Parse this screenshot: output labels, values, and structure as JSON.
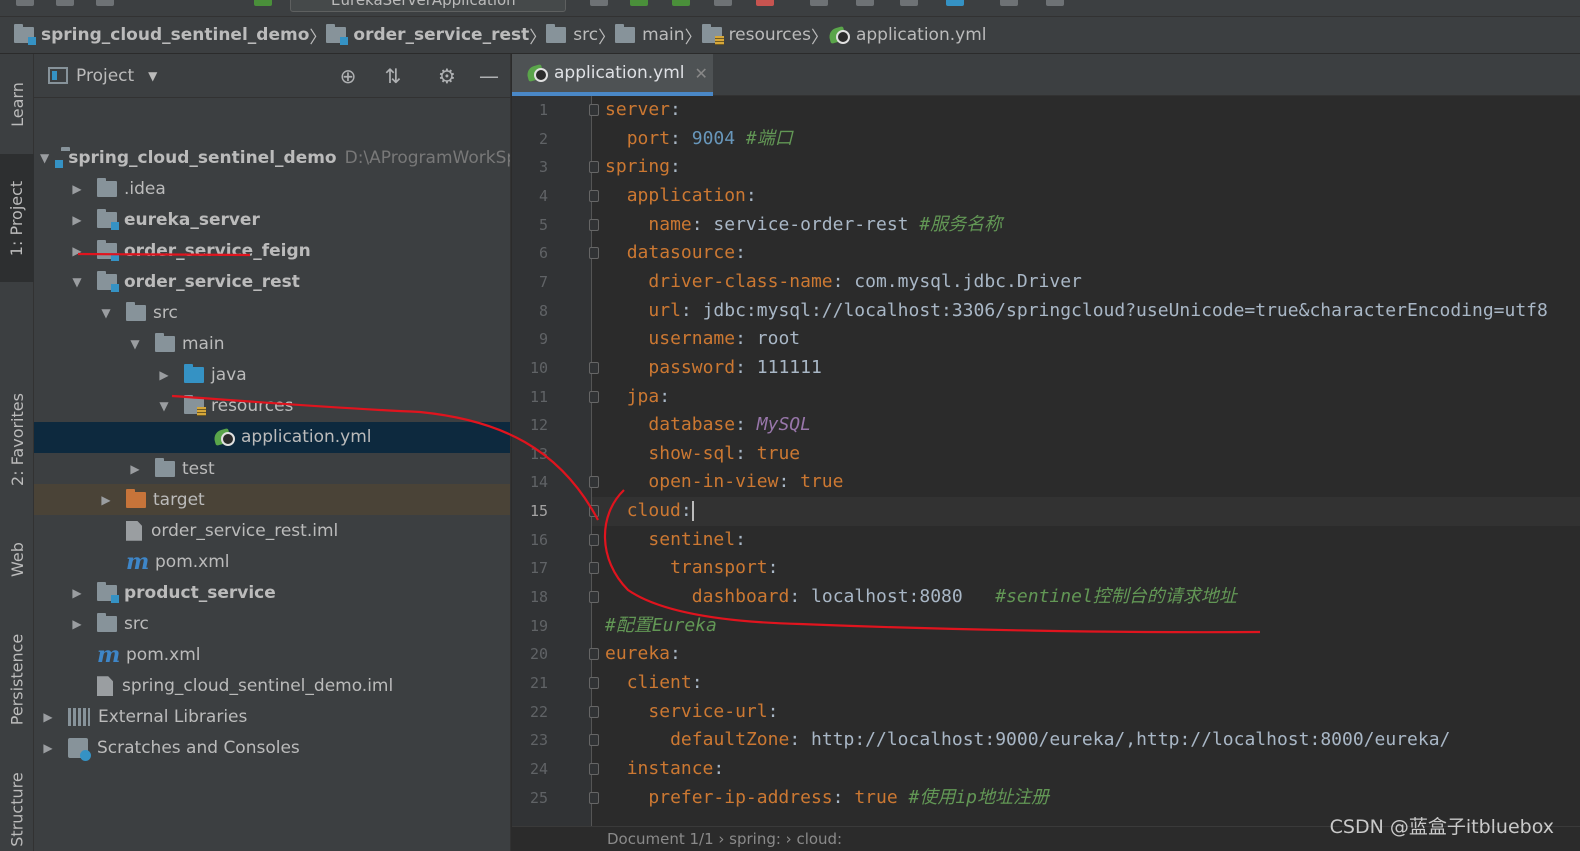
{
  "toolbar": {
    "run_config": "EurekaServerApplication"
  },
  "breadcrumb": [
    {
      "label": "spring_cloud_sentinel_demo",
      "icon": "module-folder-icon",
      "bold": true
    },
    {
      "label": "order_service_rest",
      "icon": "module-folder-icon",
      "bold": true
    },
    {
      "label": "src",
      "icon": "folder-icon",
      "bold": false
    },
    {
      "label": "main",
      "icon": "folder-icon",
      "bold": false
    },
    {
      "label": "resources",
      "icon": "resources-folder-icon",
      "bold": false
    },
    {
      "label": "application.yml",
      "icon": "yml-spring-icon",
      "bold": false
    }
  ],
  "left_strip": {
    "learn": "Learn",
    "project": "1: Project",
    "favorites": "2: Favorites",
    "web": "Web",
    "persistence": "Persistence",
    "structure": "Structure"
  },
  "project_panel": {
    "title": "Project",
    "tree": [
      {
        "label": "spring_cloud_sentinel_demo",
        "path": "D:\\AProgramWorkSp",
        "level": 0,
        "expanded": true,
        "icon": "module",
        "bold": true
      },
      {
        "label": ".idea",
        "level": 1,
        "expanded": false,
        "icon": "folder"
      },
      {
        "label": "eureka_server",
        "level": 1,
        "expanded": false,
        "icon": "module",
        "bold": true
      },
      {
        "label": "order_service_feign",
        "level": 1,
        "expanded": false,
        "icon": "module",
        "bold": true
      },
      {
        "label": "order_service_rest",
        "level": 1,
        "expanded": true,
        "icon": "module",
        "bold": true
      },
      {
        "label": "src",
        "level": 2,
        "expanded": true,
        "icon": "folder"
      },
      {
        "label": "main",
        "level": 3,
        "expanded": true,
        "icon": "folder"
      },
      {
        "label": "java",
        "level": 4,
        "expanded": false,
        "icon": "source-folder"
      },
      {
        "label": "resources",
        "level": 4,
        "expanded": true,
        "icon": "resources-folder"
      },
      {
        "label": "application.yml",
        "level": 5,
        "leaf": true,
        "icon": "yml",
        "selected": true
      },
      {
        "label": "test",
        "level": 3,
        "expanded": false,
        "icon": "folder"
      },
      {
        "label": "target",
        "level": 2,
        "expanded": false,
        "icon": "excluded-folder",
        "highlight": true
      },
      {
        "label": "order_service_rest.iml",
        "level": 2,
        "leaf": true,
        "icon": "iml"
      },
      {
        "label": "pom.xml",
        "level": 2,
        "leaf": true,
        "icon": "maven"
      },
      {
        "label": "product_service",
        "level": 1,
        "expanded": false,
        "icon": "module",
        "bold": true
      },
      {
        "label": "src",
        "level": 1,
        "expanded": false,
        "icon": "folder"
      },
      {
        "label": "pom.xml",
        "level": 1,
        "leaf": true,
        "icon": "maven"
      },
      {
        "label": "spring_cloud_sentinel_demo.iml",
        "level": 1,
        "leaf": true,
        "icon": "iml"
      },
      {
        "label": "External Libraries",
        "level": 0,
        "expanded": false,
        "icon": "libraries"
      },
      {
        "label": "Scratches and Consoles",
        "level": 0,
        "expanded": false,
        "icon": "scratches"
      }
    ]
  },
  "editor": {
    "tab_label": "application.yml",
    "current_line": 15,
    "lines": [
      {
        "no": 1,
        "indent": 0,
        "fold": true,
        "parts": [
          [
            "k",
            "server"
          ],
          [
            "v",
            ":"
          ]
        ]
      },
      {
        "no": 2,
        "indent": 1,
        "parts": [
          [
            "k",
            "port"
          ],
          [
            "v",
            ": "
          ],
          [
            "n",
            "9004 "
          ],
          [
            "c",
            "#端口"
          ]
        ]
      },
      {
        "no": 3,
        "indent": 0,
        "fold": true,
        "parts": [
          [
            "k",
            "spring"
          ],
          [
            "v",
            ":"
          ]
        ]
      },
      {
        "no": 4,
        "indent": 1,
        "fold": true,
        "parts": [
          [
            "k",
            "application"
          ],
          [
            "v",
            ":"
          ]
        ]
      },
      {
        "no": 5,
        "indent": 2,
        "fold": true,
        "parts": [
          [
            "k",
            "name"
          ],
          [
            "v",
            ": service-order-rest "
          ],
          [
            "c",
            "#服务名称"
          ]
        ]
      },
      {
        "no": 6,
        "indent": 1,
        "fold": true,
        "parts": [
          [
            "k",
            "datasource"
          ],
          [
            "v",
            ":"
          ]
        ]
      },
      {
        "no": 7,
        "indent": 2,
        "parts": [
          [
            "k",
            "driver-class-name"
          ],
          [
            "v",
            ": com.mysql.jdbc.Driver"
          ]
        ]
      },
      {
        "no": 8,
        "indent": 2,
        "parts": [
          [
            "k",
            "url"
          ],
          [
            "v",
            ": jdbc:mysql://localhost:3306/springcloud?useUnicode=true&characterEncoding=utf8"
          ]
        ]
      },
      {
        "no": 9,
        "indent": 2,
        "parts": [
          [
            "k",
            "username"
          ],
          [
            "v",
            ": root"
          ]
        ]
      },
      {
        "no": 10,
        "indent": 2,
        "fold": true,
        "parts": [
          [
            "k",
            "password"
          ],
          [
            "v",
            ": 111111"
          ]
        ]
      },
      {
        "no": 11,
        "indent": 1,
        "fold": true,
        "parts": [
          [
            "k",
            "jpa"
          ],
          [
            "v",
            ":"
          ]
        ]
      },
      {
        "no": 12,
        "indent": 2,
        "parts": [
          [
            "k",
            "database"
          ],
          [
            "v",
            ": "
          ],
          [
            "m",
            "MySQL"
          ]
        ]
      },
      {
        "no": 13,
        "indent": 2,
        "parts": [
          [
            "k",
            "show-sql"
          ],
          [
            "v",
            ": "
          ],
          [
            "k",
            "true"
          ]
        ]
      },
      {
        "no": 14,
        "indent": 2,
        "fold": true,
        "parts": [
          [
            "k",
            "open-in-view"
          ],
          [
            "v",
            ": "
          ],
          [
            "k",
            "true"
          ]
        ]
      },
      {
        "no": 15,
        "indent": 1,
        "fold": true,
        "caret": true,
        "parts": [
          [
            "k",
            "cloud"
          ],
          [
            "v",
            ":"
          ]
        ]
      },
      {
        "no": 16,
        "indent": 2,
        "fold": true,
        "parts": [
          [
            "k",
            "sentinel"
          ],
          [
            "v",
            ":"
          ]
        ]
      },
      {
        "no": 17,
        "indent": 3,
        "fold": true,
        "parts": [
          [
            "k",
            "transport"
          ],
          [
            "v",
            ":"
          ]
        ]
      },
      {
        "no": 18,
        "indent": 4,
        "fold": true,
        "parts": [
          [
            "k",
            "dashboard"
          ],
          [
            "v",
            ": localhost:8080   "
          ],
          [
            "c",
            "#sentinel控制台的请求地址"
          ]
        ]
      },
      {
        "no": 19,
        "indent": 0,
        "parts": [
          [
            "c",
            "#配置Eureka"
          ]
        ]
      },
      {
        "no": 20,
        "indent": 0,
        "fold": true,
        "parts": [
          [
            "k",
            "eureka"
          ],
          [
            "v",
            ":"
          ]
        ]
      },
      {
        "no": 21,
        "indent": 1,
        "fold": true,
        "parts": [
          [
            "k",
            "client"
          ],
          [
            "v",
            ":"
          ]
        ]
      },
      {
        "no": 22,
        "indent": 2,
        "fold": true,
        "parts": [
          [
            "k",
            "service-url"
          ],
          [
            "v",
            ":"
          ]
        ]
      },
      {
        "no": 23,
        "indent": 3,
        "fold": true,
        "parts": [
          [
            "k",
            "defaultZone"
          ],
          [
            "v",
            ": http://localhost:9000/eureka/,http://localhost:8000/eureka/"
          ]
        ]
      },
      {
        "no": 24,
        "indent": 1,
        "fold": true,
        "parts": [
          [
            "k",
            "instance"
          ],
          [
            "v",
            ":"
          ]
        ]
      },
      {
        "no": 25,
        "indent": 2,
        "fold": true,
        "parts": [
          [
            "k",
            "prefer-ip-address"
          ],
          [
            "v",
            ": "
          ],
          [
            "k",
            "true "
          ],
          [
            "c",
            "#使用ip地址注册"
          ]
        ]
      }
    ]
  },
  "status_breadcrumb": "Document 1/1  ›  spring:  ›  cloud:",
  "watermark": "CSDN @蓝盒子itbluebox",
  "colors": {
    "background": "#2b2b2b",
    "panel": "#3c3f41",
    "keyword": "#cc7832",
    "comment": "#629755",
    "number": "#6897bb",
    "annotation_ink": "#e0141e"
  }
}
